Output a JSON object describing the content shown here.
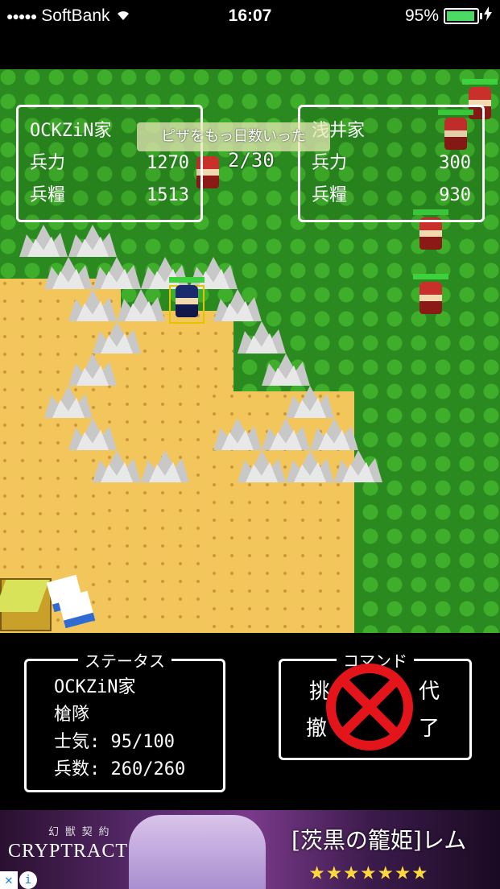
{
  "statusbar": {
    "carrier": "SoftBank",
    "time": "16:07",
    "battery": "95%",
    "battery_level_percent": 95
  },
  "notification": {
    "banner": "ピザをもっ日数いった",
    "turn": "2/30"
  },
  "player_panel": {
    "clan": "OCKZiN家",
    "troops_label": "兵力",
    "troops_value": "1270",
    "food_label": "兵糧",
    "food_value": "1513"
  },
  "enemy_panel": {
    "clan": "浅井家",
    "troops_label": "兵力",
    "troops_value": "300",
    "food_label": "兵糧",
    "food_value": "930"
  },
  "status_box": {
    "title": "ステータス",
    "clan": "OCKZiN家",
    "unit_type": "槍隊",
    "morale": "士気: 95/100",
    "soldiers": "兵数: 260/260"
  },
  "command_box": {
    "title": "コマンド",
    "cmd1": "挑",
    "cmd2": "代",
    "cmd3": "撤",
    "cmd4": "了"
  },
  "ad": {
    "brand": "CRYPTRACT",
    "subtitle": "幻 獣 契 約",
    "title": "[茨黒の籠姫]レム",
    "stars": "★★★★★★★",
    "rating_stars": 7
  },
  "colors": {
    "hp_green": "#3ed13e",
    "enemy_red": "#c9302c",
    "player_blue": "#1a2a6c",
    "forest": "#2a8a20",
    "sand": "#f2c65a"
  }
}
